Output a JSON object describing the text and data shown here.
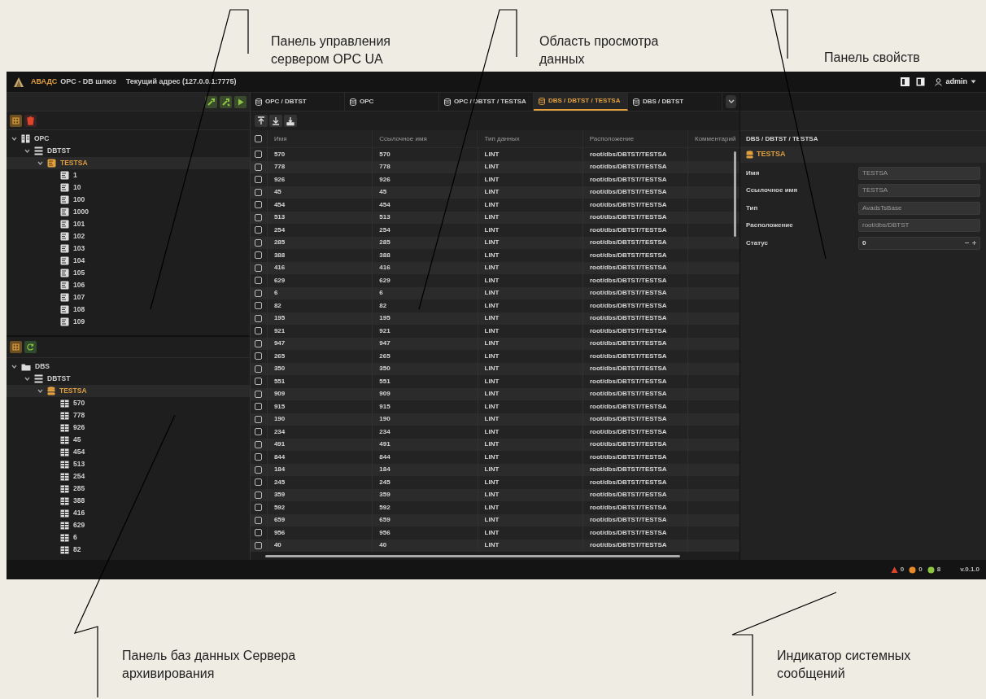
{
  "callouts": [
    {
      "text": "Панель управления сервером OPC UA"
    },
    {
      "text": "Область просмотра данных"
    },
    {
      "text": "Панель свойств"
    },
    {
      "text": "Панель баз данных Сервера архивирования"
    },
    {
      "text": "Индикатор системных сообщений"
    }
  ],
  "title_bar": {
    "app_name": "АВАДС",
    "title": "OPC - DB шлюз",
    "address": "Текущий адрес (127.0.0.1:7775)",
    "user": "admin"
  },
  "opc_panel": {
    "tree": [
      {
        "label": "OPC",
        "kind": "server",
        "expanded": true,
        "selected": false,
        "children": [
          {
            "label": "DBTST",
            "kind": "list",
            "expanded": true,
            "selected": false,
            "children": [
              {
                "label": "TESTSA",
                "kind": "group",
                "expanded": true,
                "selected": true,
                "children": [
                  {
                    "label": "1",
                    "kind": "tag",
                    "selected": false
                  },
                  {
                    "label": "10",
                    "kind": "tag",
                    "selected": false
                  },
                  {
                    "label": "100",
                    "kind": "tag",
                    "selected": false
                  },
                  {
                    "label": "1000",
                    "kind": "tag",
                    "selected": false
                  },
                  {
                    "label": "101",
                    "kind": "tag",
                    "selected": false
                  },
                  {
                    "label": "102",
                    "kind": "tag",
                    "selected": false
                  },
                  {
                    "label": "103",
                    "kind": "tag",
                    "selected": false
                  },
                  {
                    "label": "104",
                    "kind": "tag",
                    "selected": false
                  },
                  {
                    "label": "105",
                    "kind": "tag",
                    "selected": false
                  },
                  {
                    "label": "106",
                    "kind": "tag",
                    "selected": false
                  },
                  {
                    "label": "107",
                    "kind": "tag",
                    "selected": false
                  },
                  {
                    "label": "108",
                    "kind": "tag",
                    "selected": false
                  },
                  {
                    "label": "109",
                    "kind": "tag",
                    "selected": false
                  }
                ]
              }
            ]
          }
        ]
      }
    ]
  },
  "db_panel": {
    "tree": [
      {
        "label": "DBS",
        "kind": "folder",
        "expanded": true,
        "selected": false,
        "children": [
          {
            "label": "DBTST",
            "kind": "list",
            "expanded": true,
            "selected": false,
            "children": [
              {
                "label": "TESTSA",
                "kind": "database",
                "expanded": true,
                "selected": true,
                "children": [
                  {
                    "label": "570",
                    "kind": "table",
                    "selected": false
                  },
                  {
                    "label": "778",
                    "kind": "table",
                    "selected": false
                  },
                  {
                    "label": "926",
                    "kind": "table",
                    "selected": false
                  },
                  {
                    "label": "45",
                    "kind": "table",
                    "selected": false
                  },
                  {
                    "label": "454",
                    "kind": "table",
                    "selected": false
                  },
                  {
                    "label": "513",
                    "kind": "table",
                    "selected": false
                  },
                  {
                    "label": "254",
                    "kind": "table",
                    "selected": false
                  },
                  {
                    "label": "285",
                    "kind": "table",
                    "selected": false
                  },
                  {
                    "label": "388",
                    "kind": "table",
                    "selected": false
                  },
                  {
                    "label": "416",
                    "kind": "table",
                    "selected": false
                  },
                  {
                    "label": "629",
                    "kind": "table",
                    "selected": false
                  },
                  {
                    "label": "6",
                    "kind": "table",
                    "selected": false
                  },
                  {
                    "label": "82",
                    "kind": "table",
                    "selected": false
                  }
                ]
              }
            ]
          }
        ]
      }
    ]
  },
  "tabs": [
    {
      "label": "OPC / DBTST",
      "selected": false
    },
    {
      "label": "OPC",
      "selected": false
    },
    {
      "label": "OPC / DBTST / TESTSA",
      "selected": false
    },
    {
      "label": "DBS / DBTST / TESTSA",
      "selected": true
    },
    {
      "label": "DBS / DBTST",
      "selected": false
    }
  ],
  "table": {
    "header_checked": false,
    "columns": [
      "Имя",
      "Ссылочное имя",
      "Тип данных",
      "Расположение",
      "Комментарий"
    ],
    "rows": [
      {
        "name": "570",
        "ref_name": "570",
        "type": "LINT",
        "location": "root/dbs/DBTST/TESTSA",
        "checked": false
      },
      {
        "name": "778",
        "ref_name": "778",
        "type": "LINT",
        "location": "root/dbs/DBTST/TESTSA",
        "checked": false
      },
      {
        "name": "926",
        "ref_name": "926",
        "type": "LINT",
        "location": "root/dbs/DBTST/TESTSA",
        "checked": false
      },
      {
        "name": "45",
        "ref_name": "45",
        "type": "LINT",
        "location": "root/dbs/DBTST/TESTSA",
        "checked": false
      },
      {
        "name": "454",
        "ref_name": "454",
        "type": "LINT",
        "location": "root/dbs/DBTST/TESTSA",
        "checked": false
      },
      {
        "name": "513",
        "ref_name": "513",
        "type": "LINT",
        "location": "root/dbs/DBTST/TESTSA",
        "checked": false
      },
      {
        "name": "254",
        "ref_name": "254",
        "type": "LINT",
        "location": "root/dbs/DBTST/TESTSA",
        "checked": false
      },
      {
        "name": "285",
        "ref_name": "285",
        "type": "LINT",
        "location": "root/dbs/DBTST/TESTSA",
        "checked": false
      },
      {
        "name": "388",
        "ref_name": "388",
        "type": "LINT",
        "location": "root/dbs/DBTST/TESTSA",
        "checked": false
      },
      {
        "name": "416",
        "ref_name": "416",
        "type": "LINT",
        "location": "root/dbs/DBTST/TESTSA",
        "checked": false
      },
      {
        "name": "629",
        "ref_name": "629",
        "type": "LINT",
        "location": "root/dbs/DBTST/TESTSA",
        "checked": false
      },
      {
        "name": "6",
        "ref_name": "6",
        "type": "LINT",
        "location": "root/dbs/DBTST/TESTSA",
        "checked": false
      },
      {
        "name": "82",
        "ref_name": "82",
        "type": "LINT",
        "location": "root/dbs/DBTST/TESTSA",
        "checked": false
      },
      {
        "name": "195",
        "ref_name": "195",
        "type": "LINT",
        "location": "root/dbs/DBTST/TESTSA",
        "checked": false
      },
      {
        "name": "921",
        "ref_name": "921",
        "type": "LINT",
        "location": "root/dbs/DBTST/TESTSA",
        "checked": false
      },
      {
        "name": "947",
        "ref_name": "947",
        "type": "LINT",
        "location": "root/dbs/DBTST/TESTSA",
        "checked": false
      },
      {
        "name": "265",
        "ref_name": "265",
        "type": "LINT",
        "location": "root/dbs/DBTST/TESTSA",
        "checked": false
      },
      {
        "name": "350",
        "ref_name": "350",
        "type": "LINT",
        "location": "root/dbs/DBTST/TESTSA",
        "checked": false
      },
      {
        "name": "551",
        "ref_name": "551",
        "type": "LINT",
        "location": "root/dbs/DBTST/TESTSA",
        "checked": false
      },
      {
        "name": "909",
        "ref_name": "909",
        "type": "LINT",
        "location": "root/dbs/DBTST/TESTSA",
        "checked": false
      },
      {
        "name": "915",
        "ref_name": "915",
        "type": "LINT",
        "location": "root/dbs/DBTST/TESTSA",
        "checked": false
      },
      {
        "name": "190",
        "ref_name": "190",
        "type": "LINT",
        "location": "root/dbs/DBTST/TESTSA",
        "checked": false
      },
      {
        "name": "234",
        "ref_name": "234",
        "type": "LINT",
        "location": "root/dbs/DBTST/TESTSA",
        "checked": false
      },
      {
        "name": "491",
        "ref_name": "491",
        "type": "LINT",
        "location": "root/dbs/DBTST/TESTSA",
        "checked": false
      },
      {
        "name": "844",
        "ref_name": "844",
        "type": "LINT",
        "location": "root/dbs/DBTST/TESTSA",
        "checked": false
      },
      {
        "name": "184",
        "ref_name": "184",
        "type": "LINT",
        "location": "root/dbs/DBTST/TESTSA",
        "checked": false
      },
      {
        "name": "245",
        "ref_name": "245",
        "type": "LINT",
        "location": "root/dbs/DBTST/TESTSA",
        "checked": false
      },
      {
        "name": "359",
        "ref_name": "359",
        "type": "LINT",
        "location": "root/dbs/DBTST/TESTSA",
        "checked": false
      },
      {
        "name": "592",
        "ref_name": "592",
        "type": "LINT",
        "location": "root/dbs/DBTST/TESTSA",
        "checked": false
      },
      {
        "name": "659",
        "ref_name": "659",
        "type": "LINT",
        "location": "root/dbs/DBTST/TESTSA",
        "checked": false
      },
      {
        "name": "956",
        "ref_name": "956",
        "type": "LINT",
        "location": "root/dbs/DBTST/TESTSA",
        "checked": false
      },
      {
        "name": "40",
        "ref_name": "40",
        "type": "LINT",
        "location": "root/dbs/DBTST/TESTSA",
        "checked": false
      }
    ]
  },
  "properties": {
    "breadcrumb": "DBS / DBTST / TESTSA",
    "header": "TESTSA",
    "fields": [
      {
        "label": "Имя",
        "value": "TESTSA",
        "kind": "text",
        "disabled": true
      },
      {
        "label": "Ссылочное имя",
        "value": "TESTSA",
        "kind": "text",
        "disabled": true
      },
      {
        "label": "Тип",
        "value": "AvadsTsBase",
        "kind": "text",
        "disabled": true
      },
      {
        "label": "Расположение",
        "value": "root/dbs/DBTST",
        "kind": "text",
        "disabled": true
      },
      {
        "label": "Статус",
        "value": "0",
        "kind": "spinner",
        "disabled": false
      }
    ]
  },
  "status_bar": {
    "counters": [
      {
        "kind": "error",
        "count": "0",
        "color": "#e0452c"
      },
      {
        "kind": "warning",
        "count": "0",
        "color": "#e8892a"
      },
      {
        "kind": "info",
        "count": "8",
        "color": "#8dc63f"
      }
    ],
    "version": "v.0.1.0"
  }
}
